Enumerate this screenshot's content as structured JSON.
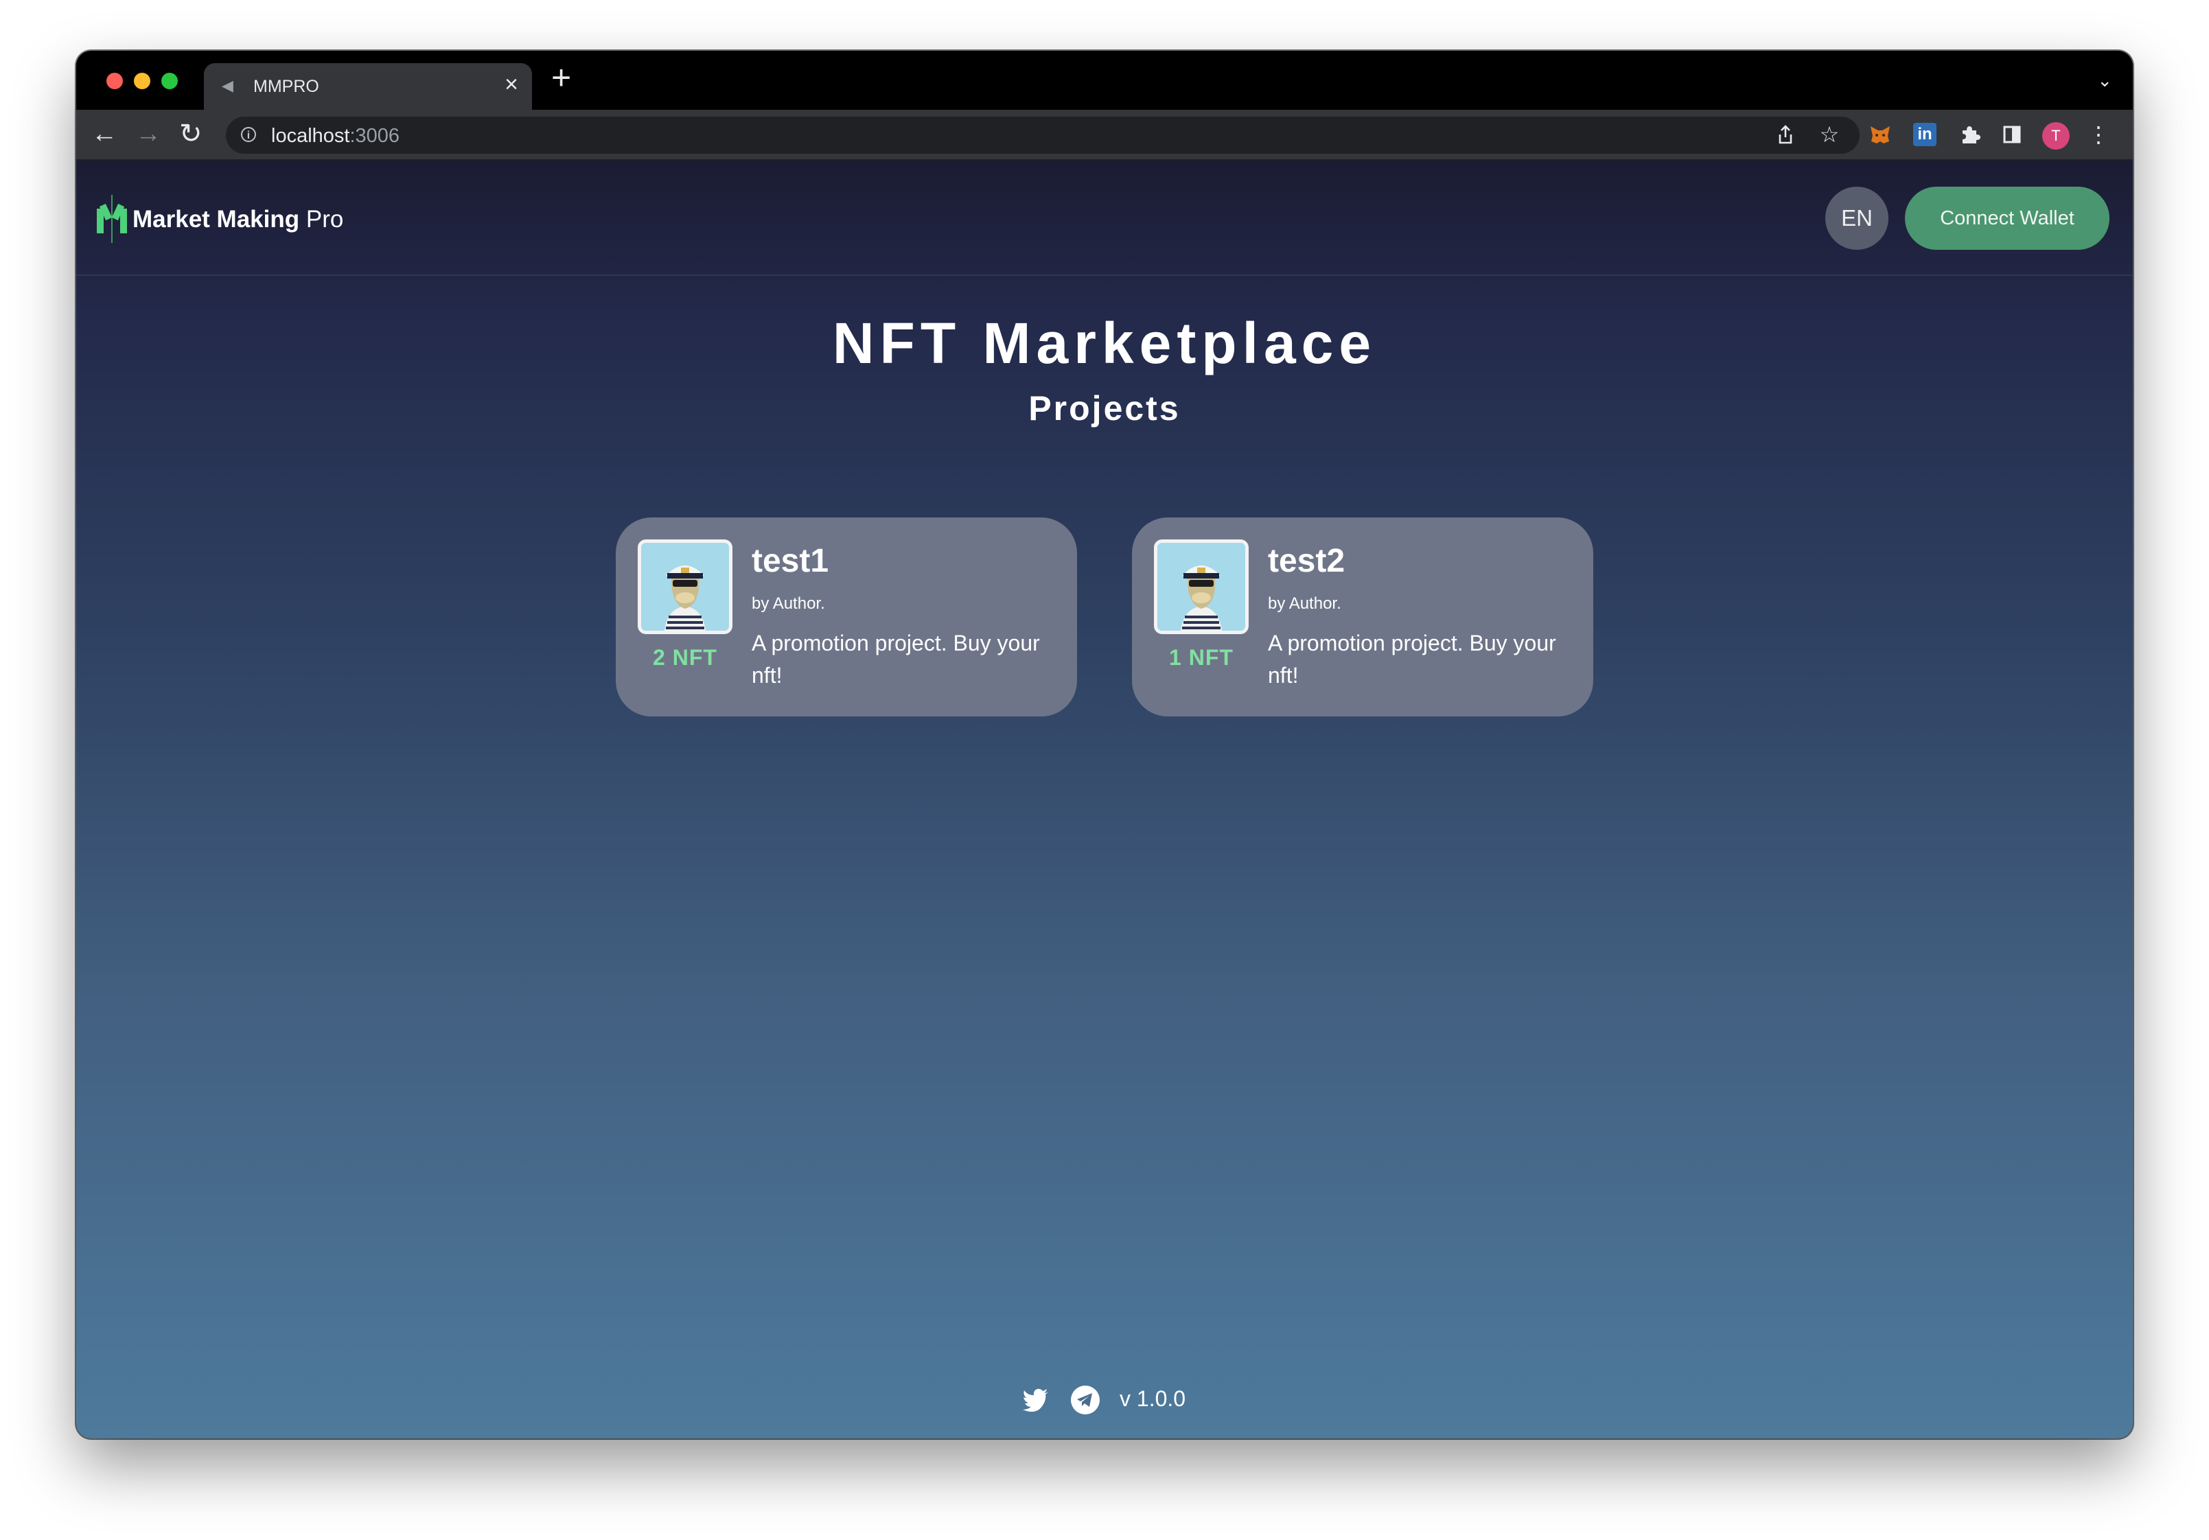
{
  "browser": {
    "tab_title": "MMPRO",
    "new_tab_symbol": "+",
    "url_host": "localhost",
    "url_port": ":3006"
  },
  "header": {
    "logo_bold": "Market Making",
    "logo_light": "Pro",
    "language": "EN",
    "connect_label": "Connect Wallet"
  },
  "hero": {
    "title": "NFT Marketplace",
    "subtitle": "Projects"
  },
  "projects": [
    {
      "name": "test1",
      "author": "by Author.",
      "description": "A promotion project. Buy your nft!",
      "count": "2 NFT"
    },
    {
      "name": "test2",
      "author": "by Author.",
      "description": "A promotion project. Buy your nft!",
      "count": "1 NFT"
    }
  ],
  "footer": {
    "version": "v 1.0.0"
  },
  "colors": {
    "accent_green": "#4a9670",
    "count_green": "#82e0a0",
    "card_bg": "#6e7588"
  },
  "icons": [
    "twitter-icon",
    "telegram-icon",
    "info-icon",
    "share-icon",
    "star-icon",
    "metamask-icon",
    "linkedin-icon",
    "puzzle-icon",
    "sidebar-icon",
    "more-icon"
  ]
}
